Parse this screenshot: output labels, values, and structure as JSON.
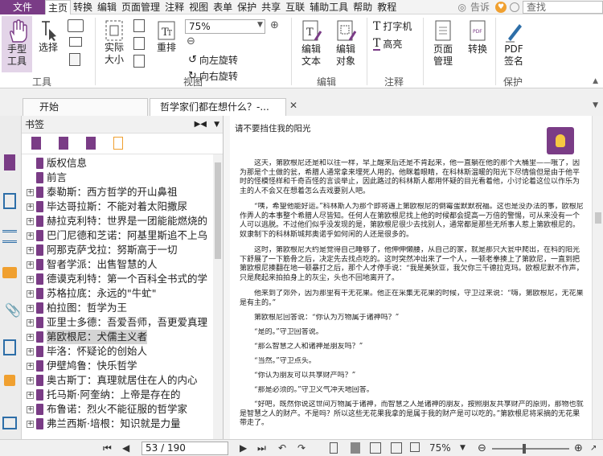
{
  "menubar": {
    "file": "文件",
    "items": [
      "主页",
      "转换",
      "编辑",
      "页面管理",
      "注释",
      "视图",
      "表单",
      "保护",
      "共享",
      "互联",
      "辅助工具",
      "帮助",
      "教程"
    ],
    "tell_me": "告诉",
    "search_placeholder": "查找"
  },
  "ribbon": {
    "hand_tool": "手型\n工具",
    "select": "选择",
    "actual_size": "实际\n大小",
    "reflow": "重排",
    "zoom_value": "75%",
    "rotate_left": "向左旋转",
    "rotate_right": "向右旋转",
    "edit_text": "编辑\n文本",
    "edit_object": "编辑\n对象",
    "typewriter": "打字机",
    "highlight": "高亮",
    "page_manage": "页面\n管理",
    "convert": "转换",
    "pdf_sign": "PDF\n签名",
    "groups": {
      "tools": "工具",
      "view": "视图",
      "edit": "编辑",
      "comment": "注释",
      "protect": "保护"
    }
  },
  "tabs": [
    {
      "label": "开始"
    },
    {
      "label": "哲学家们都在想什么？-..."
    }
  ],
  "bookmarks": {
    "title": "书签",
    "items": [
      {
        "label": "版权信息",
        "expandable": false
      },
      {
        "label": "前言",
        "expandable": false
      },
      {
        "label": "泰勒斯：西方哲学的开山鼻祖",
        "expandable": true
      },
      {
        "label": "毕达哥拉斯：不能对着太阳撒尿",
        "expandable": true
      },
      {
        "label": "赫拉克利特：世界是一团能能燃烧的",
        "expandable": true
      },
      {
        "label": "巴门尼德和芝诺：阿基里斯追不上乌",
        "expandable": true
      },
      {
        "label": "阿那克萨戈拉：努斯高于一切",
        "expandable": true
      },
      {
        "label": "智者学派：出售智慧的人",
        "expandable": true
      },
      {
        "label": "德谟克利特：第一个百科全书式的学",
        "expandable": true
      },
      {
        "label": "苏格拉底：永远的\"牛虻\"",
        "expandable": true
      },
      {
        "label": "柏拉图：哲学为王",
        "expandable": true
      },
      {
        "label": "亚里士多德：吾爱吾师，吾更爱真理",
        "expandable": true
      },
      {
        "label": "第欧根尼：犬儒主义者",
        "expandable": true,
        "selected": true
      },
      {
        "label": "毕洛：怀疑论的创始人",
        "expandable": true
      },
      {
        "label": "伊壁鸠鲁：快乐哲学",
        "expandable": true
      },
      {
        "label": "奥古斯丁：真理就居住在人的内心",
        "expandable": true
      },
      {
        "label": "托马斯·阿奎纳：上帝是存在的",
        "expandable": true
      },
      {
        "label": "布鲁诺：烈火不能征服的哲学家",
        "expandable": true
      },
      {
        "label": "弗兰西斯·培根：知识就是力量",
        "expandable": true
      }
    ]
  },
  "document": {
    "heading": "请不要挡住我的阳光",
    "paragraphs": [
      "这天，第欧根尼还是和以往一样，早上醒来后还是不肯起来，他一直躺在他的那个大桶里——哦了，因为那是个土做的瓮，希腊人通常拿来埋死人用的。他眯着眼睛，在科林斯温暖的阳光下尽情偷但是由于他平时的怪模怪样和千奇百怪的言谈举止，因此路过的科林斯人都用怀疑的目光看着他，小讨论着这位以作乐为主的人不会又在想着怎么去戏要别人吧。",
      "“咦，希望他能好运。”科林斯人为那个即将遇上第欧根尼的倒霉蛋默默祝福。这也是没办法的事，欧根尼作弄人的本事整个希腊人尽皆知。任何人在第欧根尼找上他的时候都会提高一万倍的警惕，可从来没有一个人可以逃脱。不过他们似乎没发现的是，第欧根尼很少去找别人，通常都是那些无所事人惹上第欧根尼的。奴隶制下的科林斯城邦奥诺乎如何闲的人还是很多的。",
      "这时，第欧根尼大约是觉得自己睡够了，他伸伸懒腰，从自己的家，就是那只大瓮中爬出，在科的阳光下舒展了一下筋骨之后，决定先去找点吃的。这时突然冲出来了一个人，一顿老拳揍上了第欧尼，一直到把第欧根尼揍翻在地一顿暴打之后，那个人才停手说：“我是美狄亚，我欠你三千德拉克玛。欧根尼默不作声，只是爬起来拍拍身上的灰尘，头也不回地离开了。",
      "他来到了郊外，因为那里有干无花果。他正在采集无花果的时候，守卫过来说：“嗨，第欧根尼，无花果是有主的。”",
      "第欧根尼回答说：“你认为万物属于诸神吗？”",
      "“是的。”守卫回答说。",
      "“那么智慧之人和诸神是朋友吗？”",
      "“当然。”守卫点头。",
      "“你认为朋友可以共享财产吗？”",
      "“那是必须的。”守卫义气冲天地回答。",
      "“好吧，既然你说这世间万物属于诸神，而智慧之人是诸神的朋友，按照朋友共享财产的原则，那物也就是智慧之人的财产。不是吗？所以这些无花果我拿的是属于我的财产是可以吃的。”第欧根尼将采摘的无花果带走了。"
    ]
  },
  "status": {
    "page_display": "53 / 190",
    "zoom": "75%"
  },
  "colors": {
    "brand": "#7a3c86"
  }
}
